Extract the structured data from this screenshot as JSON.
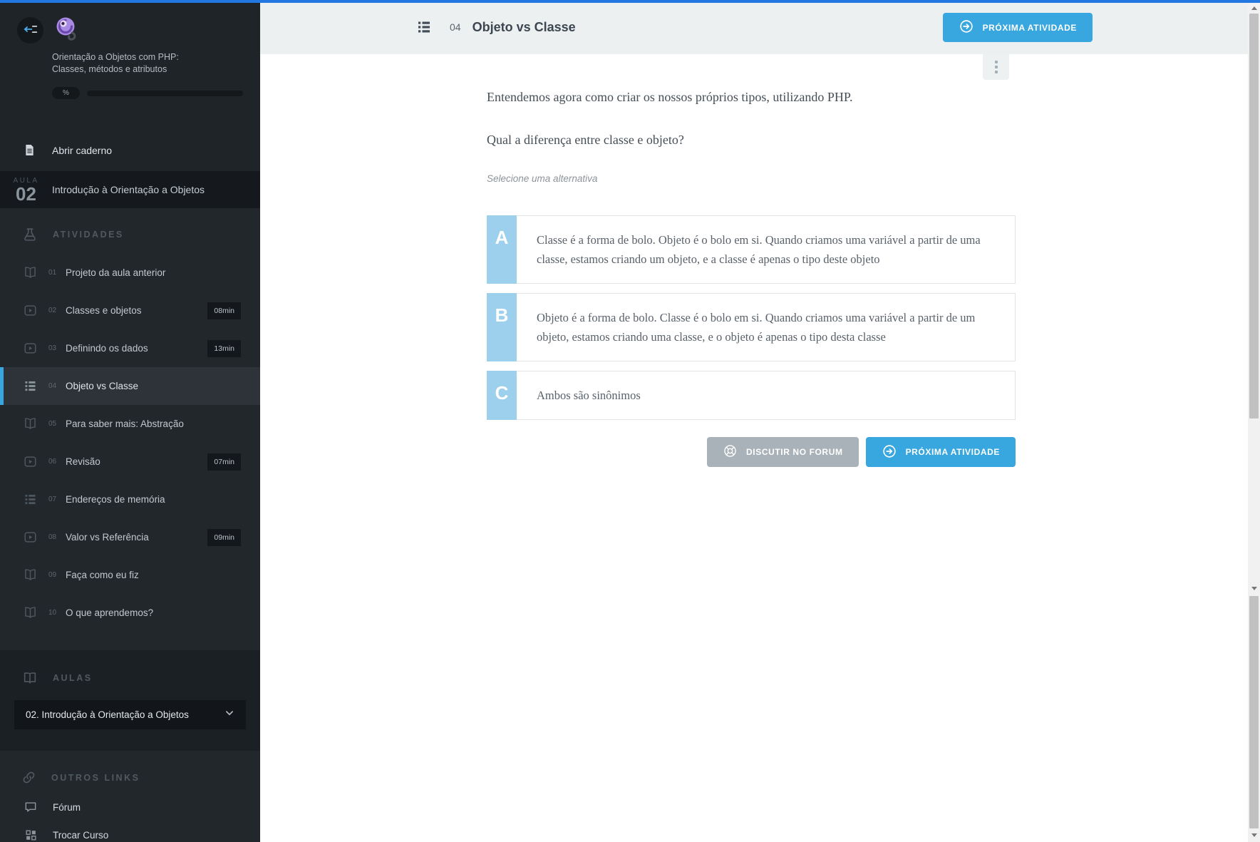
{
  "colors": {
    "topbar_blue": "#2277e0",
    "accent_blue": "#38a7e0",
    "letter_blue": "#9dd0ed",
    "sidebar_bg": "#22272c",
    "header_bg": "#edf0f1"
  },
  "sidebar": {
    "course_title_line1": "Orientação a Objetos com PHP:",
    "course_title_line2": "Classes, métodos e atributos",
    "progress_label": "%",
    "notebook_label": "Abrir caderno",
    "lesson": {
      "kicker": "AULA",
      "number": "02",
      "title": "Introdução à Orientação a Objetos"
    },
    "activities_header": "ATIVIDADES",
    "activities": [
      {
        "num": "01",
        "label": "Projeto da aula anterior",
        "icon": "book",
        "duration": "",
        "active": false
      },
      {
        "num": "02",
        "label": "Classes e objetos",
        "icon": "video",
        "duration": "08min",
        "active": false
      },
      {
        "num": "03",
        "label": "Definindo os dados",
        "icon": "video",
        "duration": "13min",
        "active": false
      },
      {
        "num": "04",
        "label": "Objeto vs Classe",
        "icon": "list",
        "duration": "",
        "active": true
      },
      {
        "num": "05",
        "label": "Para saber mais: Abstração",
        "icon": "book",
        "duration": "",
        "active": false
      },
      {
        "num": "06",
        "label": "Revisão",
        "icon": "video",
        "duration": "07min",
        "active": false
      },
      {
        "num": "07",
        "label": "Endereços de memória",
        "icon": "list",
        "duration": "",
        "active": false
      },
      {
        "num": "08",
        "label": "Valor vs Referência",
        "icon": "video",
        "duration": "09min",
        "active": false
      },
      {
        "num": "09",
        "label": "Faça como eu fiz",
        "icon": "book",
        "duration": "",
        "active": false
      },
      {
        "num": "10",
        "label": "O que aprendemos?",
        "icon": "book",
        "duration": "",
        "active": false
      }
    ],
    "aulas_header": "AULAS",
    "aulas_selected": "02. Introdução à Orientação a Objetos",
    "links_header": "OUTROS LINKS",
    "links": [
      {
        "label": "Fórum",
        "icon": "chat"
      },
      {
        "label": "Trocar Curso",
        "icon": "grid"
      }
    ]
  },
  "header": {
    "number": "04",
    "title": "Objeto vs Classe",
    "next_button": "PRÓXIMA ATIVIDADE"
  },
  "question": {
    "paragraphs": [
      "Entendemos agora como criar os nossos próprios tipos, utilizando PHP.",
      "Qual a diferença entre classe e objeto?"
    ],
    "hint": "Selecione uma alternativa",
    "alternatives": [
      {
        "letter": "A",
        "text": "Classe é a forma de bolo. Objeto é o bolo em si. Quando criamos uma variável a partir de uma classe, estamos criando um objeto, e a classe é apenas o tipo deste objeto"
      },
      {
        "letter": "B",
        "text": "Objeto é a forma de bolo. Classe é o bolo em si. Quando criamos uma variável a partir de um objeto, estamos criando uma classe, e o objeto é apenas o tipo desta classe"
      },
      {
        "letter": "C",
        "text": "Ambos são sinônimos"
      }
    ],
    "discuss_button": "DISCUTIR NO FORUM",
    "next_button": "PRÓXIMA ATIVIDADE"
  }
}
